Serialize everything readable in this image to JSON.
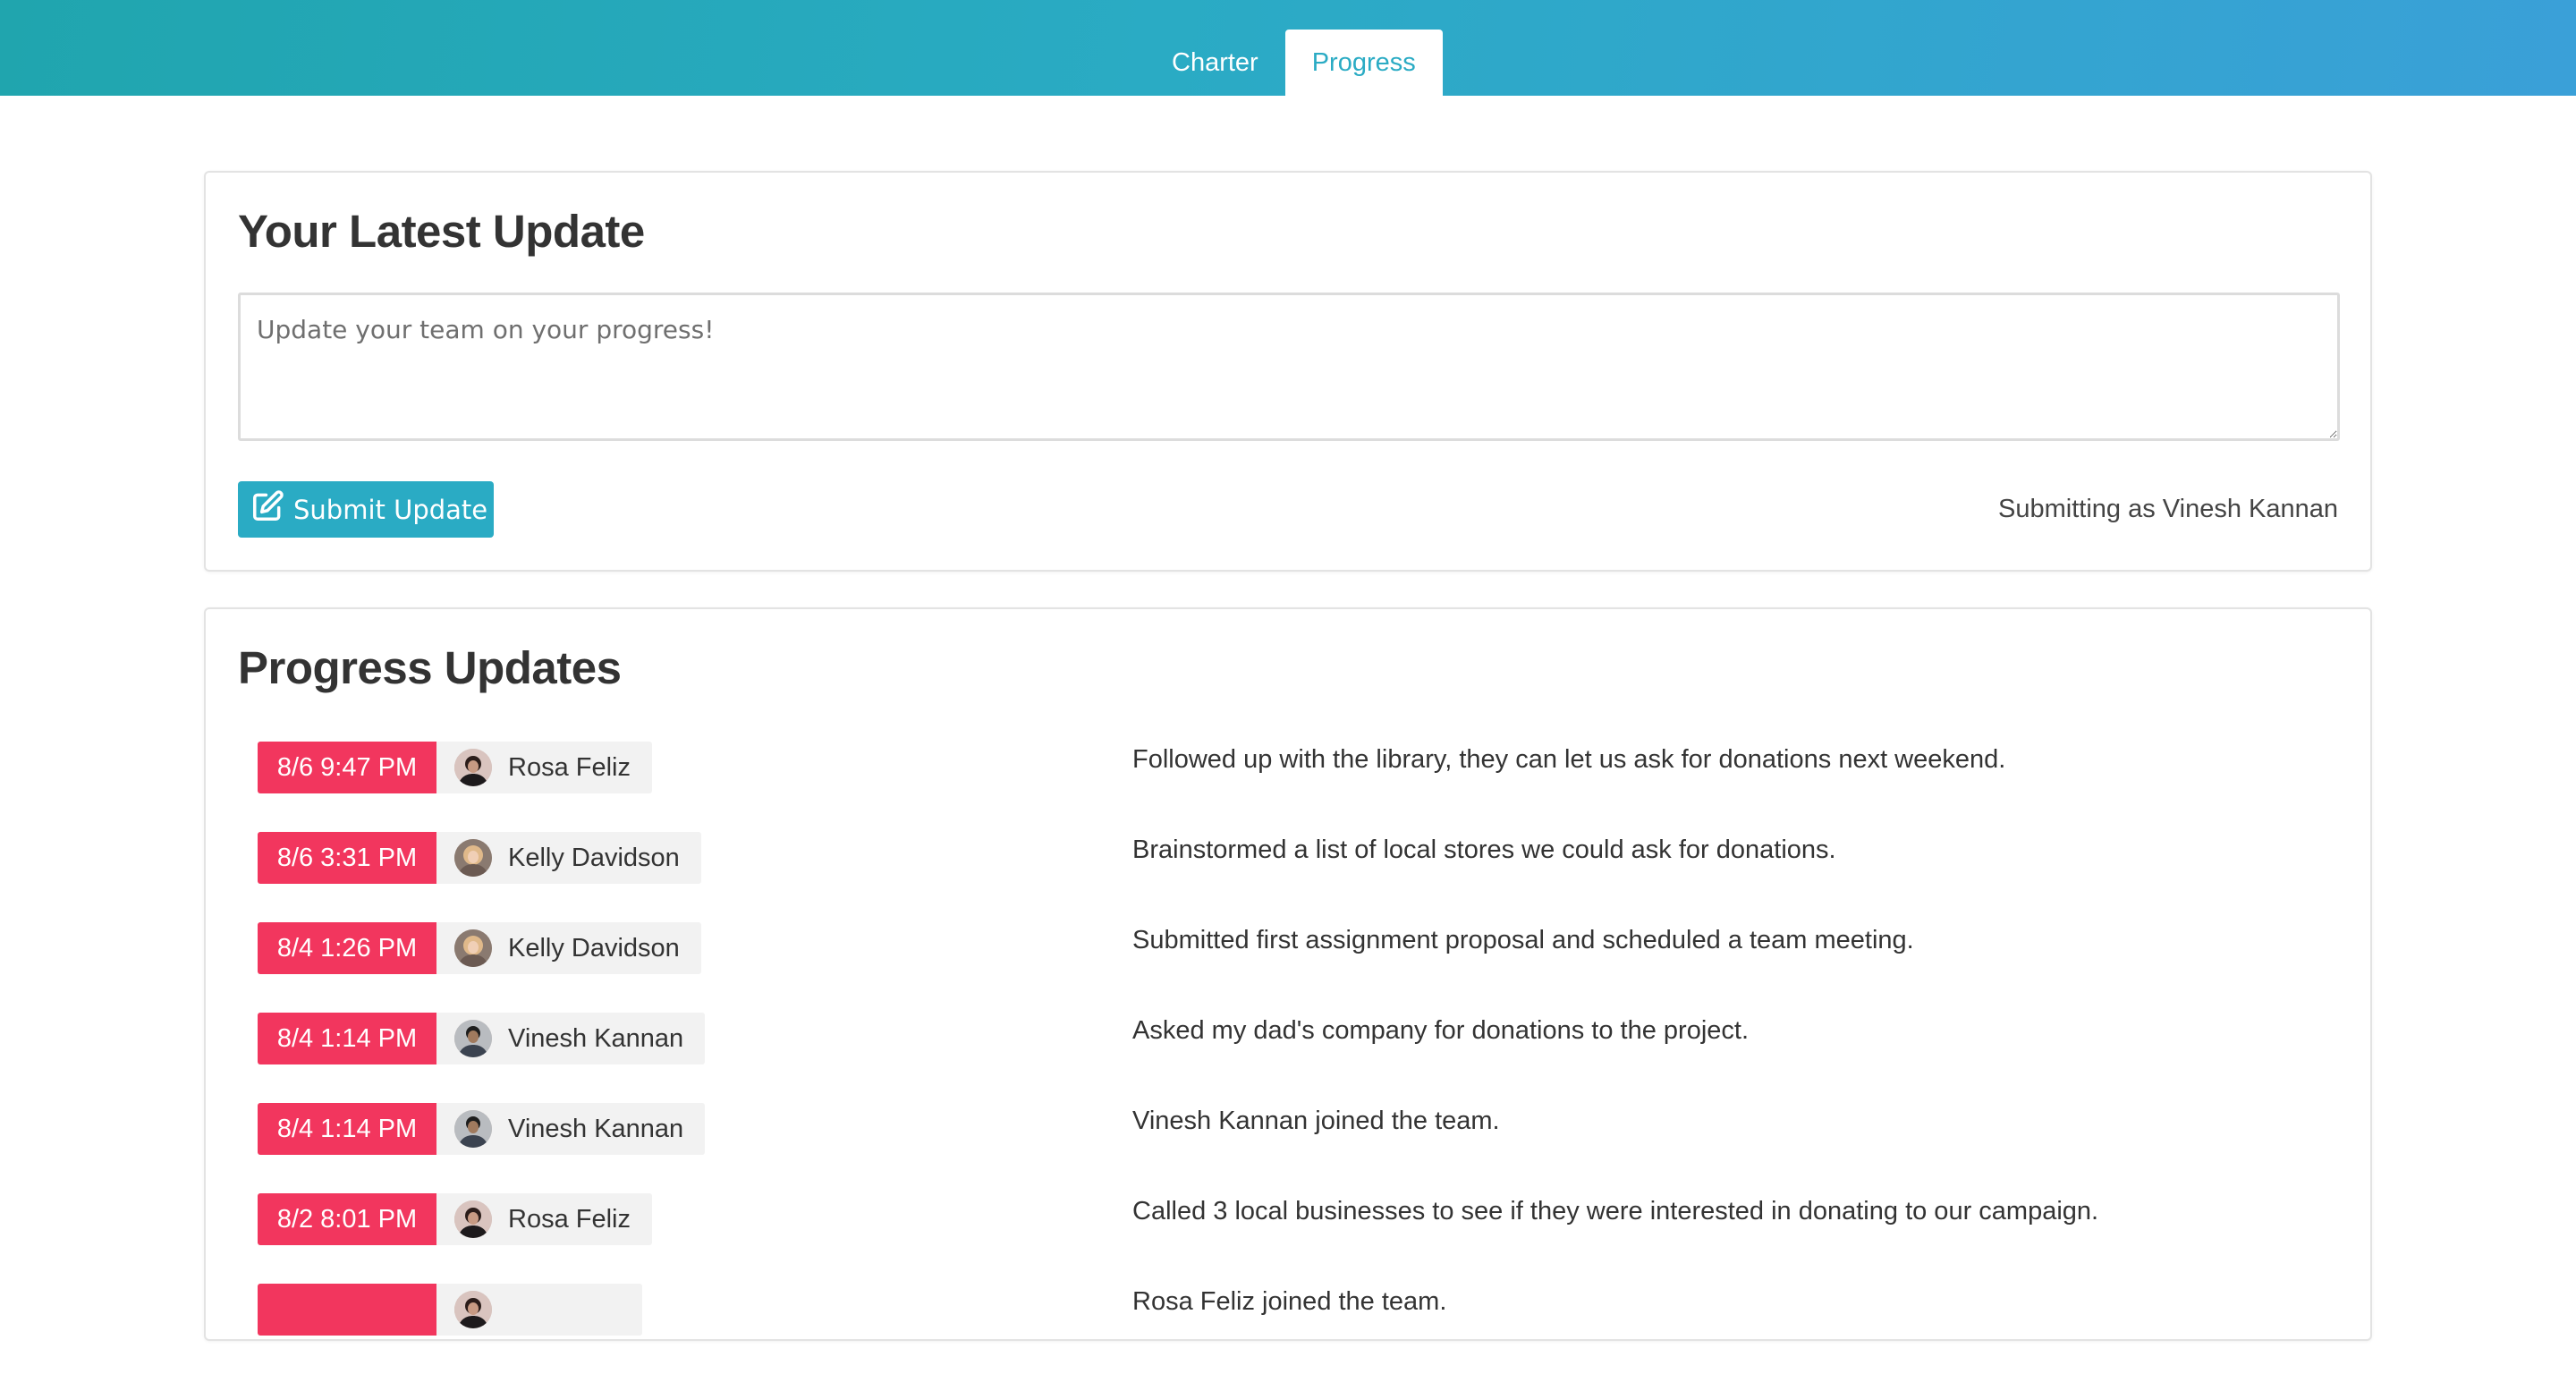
{
  "header": {
    "tabs": [
      {
        "label": "Charter",
        "active": false
      },
      {
        "label": "Progress",
        "active": true
      }
    ]
  },
  "latest_update": {
    "title": "Your Latest Update",
    "placeholder": "Update your team on your progress!",
    "value": "",
    "submit_label": "Submit Update",
    "submit_icon": "edit-icon",
    "submitting_as": "Submitting as Vinesh Kannan"
  },
  "progress": {
    "title": "Progress Updates",
    "updates": [
      {
        "time": "8/6 9:47 PM",
        "author": "Rosa Feliz",
        "avatar": "avatar-rosa",
        "text": "Followed up with the library, they can let us ask for donations next weekend."
      },
      {
        "time": "8/6 3:31 PM",
        "author": "Kelly Davidson",
        "avatar": "avatar-kelly",
        "text": "Brainstormed a list of local stores we could ask for donations."
      },
      {
        "time": "8/4 1:26 PM",
        "author": "Kelly Davidson",
        "avatar": "avatar-kelly",
        "text": "Submitted first assignment proposal and scheduled a team meeting."
      },
      {
        "time": "8/4 1:14 PM",
        "author": "Vinesh Kannan",
        "avatar": "avatar-vinesh",
        "text": "Asked my dad's company for donations to the project."
      },
      {
        "time": "8/4 1:14 PM",
        "author": "Vinesh Kannan",
        "avatar": "avatar-vinesh",
        "text": "Vinesh Kannan joined the team."
      },
      {
        "time": "8/2 8:01 PM",
        "author": "Rosa Feliz",
        "avatar": "avatar-rosa",
        "text": "Called 3 local businesses to see if they were interested in donating to our campaign."
      },
      {
        "time": "",
        "author": "",
        "avatar": "avatar-rosa",
        "text": "Rosa Feliz joined the team."
      }
    ]
  },
  "colors": {
    "accent": "#2aabc4",
    "badge": "#f2365e",
    "author_bg": "#f2f2f2"
  }
}
